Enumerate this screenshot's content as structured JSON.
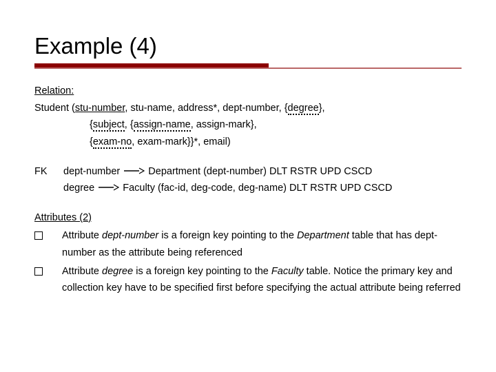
{
  "title": "Example (4)",
  "relation": {
    "heading": "Relation:",
    "line1_a": "Student (",
    "line1_pk": "stu-number",
    "line1_b": ", stu-name, address*, dept-number, {",
    "line1_ck1": "degree",
    "line1_c": "},",
    "line2_a": "{",
    "line2_ck2": "subject",
    "line2_b": ", {",
    "line2_ck3": "assign-name",
    "line2_c": ", assign-mark},",
    "line3_a": "{",
    "line3_ck4": "exam-no",
    "line3_b": ", exam-mark}}*, email)"
  },
  "fk": {
    "label": "FK",
    "line1_a": "dept-number",
    "line1_b": "Department (dept-number) DLT RSTR UPD CSCD",
    "line2_a": "degree",
    "line2_b": "Faculty (fac-id, deg-code, deg-name) DLT RSTR UPD CSCD"
  },
  "attrs": {
    "heading": "Attributes (2)",
    "b1_a": "Attribute ",
    "b1_i1": "dept-number",
    "b1_b": " is a foreign key pointing to the ",
    "b1_i2": "Department",
    "b1_c": " table that has dept-number as the attribute being referenced",
    "b2_a": "Attribute ",
    "b2_i1": "degree",
    "b2_b": " is a foreign key pointing to the ",
    "b2_i2": "Faculty",
    "b2_c": " table. Notice the primary key and collection key have to be specified first before specifying the actual attribute being referred"
  }
}
